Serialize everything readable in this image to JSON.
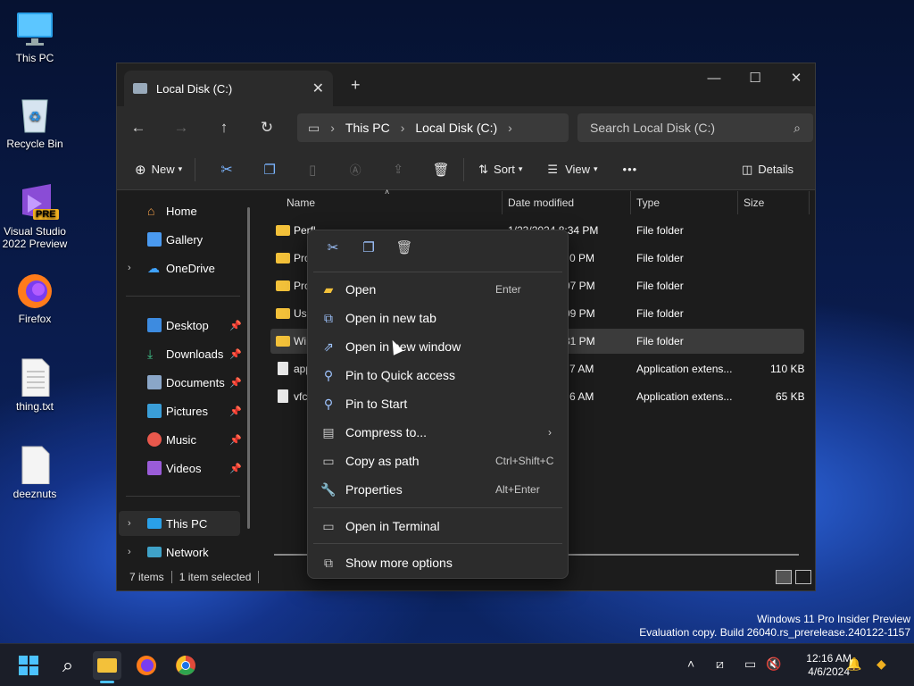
{
  "desktop": {
    "icons": [
      {
        "label": "This PC"
      },
      {
        "label": "Recycle Bin"
      },
      {
        "label": "Visual Studio 2022 Preview"
      },
      {
        "label": "Firefox"
      },
      {
        "label": "thing.txt"
      },
      {
        "label": "deeznuts"
      }
    ],
    "vs_badge": "PRE"
  },
  "explorer": {
    "tab_title": "Local Disk (C:)",
    "new_tab": "+",
    "breadcrumb": [
      "This PC",
      "Local Disk (C:)"
    ],
    "search_placeholder": "Search Local Disk (C:)",
    "toolbar": {
      "new_label": "New",
      "sort_label": "Sort",
      "view_label": "View",
      "more_label": "•••",
      "details_label": "Details"
    },
    "sidebar": {
      "items": [
        {
          "label": "Home"
        },
        {
          "label": "Gallery"
        },
        {
          "label": "OneDrive"
        },
        {
          "label": "Desktop"
        },
        {
          "label": "Downloads"
        },
        {
          "label": "Documents"
        },
        {
          "label": "Pictures"
        },
        {
          "label": "Music"
        },
        {
          "label": "Videos"
        },
        {
          "label": "This PC"
        },
        {
          "label": "Network"
        }
      ]
    },
    "columns": [
      "Name",
      "Date modified",
      "Type",
      "Size"
    ],
    "rows": [
      {
        "name": "Perfl",
        "date": "1/23/2024 8:34 PM",
        "type": "File folder",
        "size": ""
      },
      {
        "name": "Pro",
        "date": "0 PM",
        "type": "File folder",
        "size": ""
      },
      {
        "name": "Pro",
        "date": "07 PM",
        "type": "File folder",
        "size": ""
      },
      {
        "name": "Use",
        "date": "09 PM",
        "type": "File folder",
        "size": ""
      },
      {
        "name": "Wi",
        "date": "31 PM",
        "type": "File folder",
        "size": ""
      },
      {
        "name": "app",
        "date": "7 AM",
        "type": "Application extens...",
        "size": "110 KB"
      },
      {
        "name": "vfc",
        "date": "6 AM",
        "type": "Application extens...",
        "size": "65 KB"
      }
    ],
    "status": {
      "item_count": "7 items",
      "selection": "1 item selected"
    }
  },
  "context_menu": {
    "items": [
      {
        "label": "Open",
        "shortcut": "Enter",
        "icon": "folder-open-icon"
      },
      {
        "label": "Open in new tab",
        "shortcut": "",
        "icon": "new-tab-icon"
      },
      {
        "label": "Open in new window",
        "shortcut": "",
        "icon": "new-window-icon"
      },
      {
        "label": "Pin to Quick access",
        "shortcut": "",
        "icon": "pin-icon"
      },
      {
        "label": "Pin to Start",
        "shortcut": "",
        "icon": "pin-icon"
      },
      {
        "label": "Compress to...",
        "shortcut": "",
        "icon": "zip-icon"
      },
      {
        "label": "Copy as path",
        "shortcut": "Ctrl+Shift+C",
        "icon": "copy-path-icon"
      },
      {
        "label": "Properties",
        "shortcut": "Alt+Enter",
        "icon": "wrench-icon"
      },
      {
        "label": "Open in Terminal",
        "shortcut": "",
        "icon": "terminal-icon"
      },
      {
        "label": "Show more options",
        "shortcut": "",
        "icon": "more-options-icon"
      }
    ]
  },
  "watermark": {
    "line1": "Windows 11 Pro Insider Preview",
    "line2": "Evaluation copy. Build 26040.rs_prerelease.240122-1157"
  },
  "taskbar": {
    "time": "12:16 AM",
    "date": "4/6/2024"
  },
  "colors": {
    "accent": "#9fc4ff",
    "folder": "#f3c13a",
    "window_bg": "#1c1c1c",
    "menu_bg": "#2c2c2c"
  }
}
